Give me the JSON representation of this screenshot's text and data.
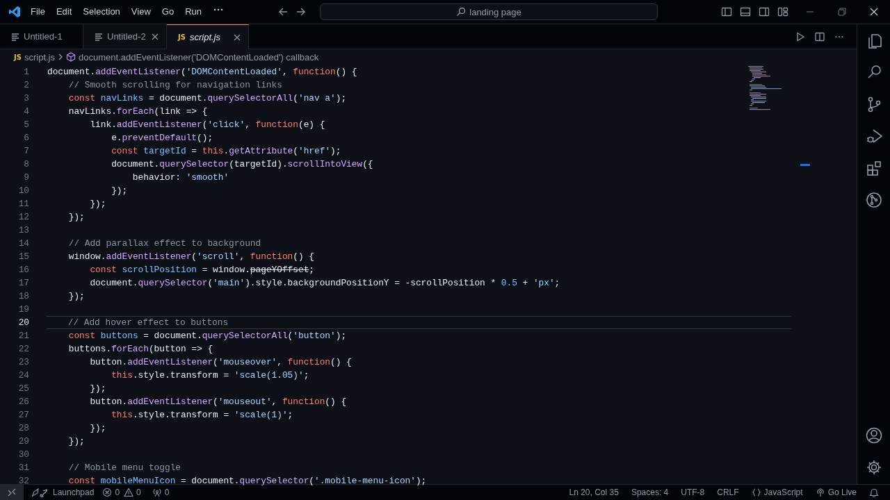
{
  "title_bar": {
    "menu": [
      "File",
      "Edit",
      "Selection",
      "View",
      "Go",
      "Run"
    ],
    "search": {
      "value": "landing page"
    }
  },
  "tabs": [
    {
      "label": "Untitled-1",
      "kind": "text",
      "selected": false,
      "hovered": false,
      "preview": false
    },
    {
      "label": "Untitled-2",
      "kind": "text",
      "selected": false,
      "hovered": true,
      "preview": false
    },
    {
      "label": "script.js",
      "kind": "js",
      "icon_text": "JS",
      "selected": true,
      "hovered": false,
      "preview": true
    }
  ],
  "breadcrumb": [
    {
      "label": "script.js",
      "kind": "js",
      "icon_text": "JS"
    },
    {
      "label": "document.addEventListener('DOMContentLoaded') callback",
      "kind": "symbol"
    }
  ],
  "editor": {
    "lines": [
      {
        "number": "1",
        "current": false,
        "tokens": [
          {
            "kind": "plain",
            "text": "document."
          },
          {
            "kind": "fn",
            "text": "addEventListener"
          },
          {
            "kind": "plain",
            "text": "("
          },
          {
            "kind": "str",
            "text": "'DOMContentLoaded'"
          },
          {
            "kind": "plain",
            "text": ", "
          },
          {
            "kind": "kw",
            "text": "function"
          },
          {
            "kind": "plain",
            "text": "() {"
          }
        ]
      },
      {
        "number": "2",
        "current": false,
        "tokens": [
          {
            "kind": "com",
            "text": "    // Smooth scrolling for navigation links"
          }
        ]
      },
      {
        "number": "3",
        "current": false,
        "tokens": [
          {
            "kind": "kw",
            "text": "    const"
          },
          {
            "kind": "def",
            "text": " navLinks"
          },
          {
            "kind": "plain",
            "text": " = document."
          },
          {
            "kind": "fn",
            "text": "querySelectorAll"
          },
          {
            "kind": "plain",
            "text": "("
          },
          {
            "kind": "str",
            "text": "'nav a'"
          },
          {
            "kind": "plain",
            "text": ");"
          }
        ]
      },
      {
        "number": "4",
        "current": false,
        "tokens": [
          {
            "kind": "plain",
            "text": "    navLinks."
          },
          {
            "kind": "fn",
            "text": "forEach"
          },
          {
            "kind": "plain",
            "text": "(link => {"
          }
        ]
      },
      {
        "number": "5",
        "current": false,
        "tokens": [
          {
            "kind": "plain",
            "text": "        link."
          },
          {
            "kind": "fn",
            "text": "addEventListener"
          },
          {
            "kind": "plain",
            "text": "("
          },
          {
            "kind": "str",
            "text": "'click'"
          },
          {
            "kind": "plain",
            "text": ", "
          },
          {
            "kind": "kw",
            "text": "function"
          },
          {
            "kind": "plain",
            "text": "(e) {"
          }
        ]
      },
      {
        "number": "6",
        "current": false,
        "tokens": [
          {
            "kind": "plain",
            "text": "            e."
          },
          {
            "kind": "fn",
            "text": "preventDefault"
          },
          {
            "kind": "plain",
            "text": "();"
          }
        ]
      },
      {
        "number": "7",
        "current": false,
        "tokens": [
          {
            "kind": "kw",
            "text": "            const"
          },
          {
            "kind": "def",
            "text": " targetId"
          },
          {
            "kind": "plain",
            "text": " = "
          },
          {
            "kind": "kw",
            "text": "this"
          },
          {
            "kind": "plain",
            "text": "."
          },
          {
            "kind": "fn",
            "text": "getAttribute"
          },
          {
            "kind": "plain",
            "text": "("
          },
          {
            "kind": "str",
            "text": "'href'"
          },
          {
            "kind": "plain",
            "text": ");"
          }
        ]
      },
      {
        "number": "8",
        "current": false,
        "tokens": [
          {
            "kind": "plain",
            "text": "            document."
          },
          {
            "kind": "fn",
            "text": "querySelector"
          },
          {
            "kind": "plain",
            "text": "(targetId)."
          },
          {
            "kind": "fn",
            "text": "scrollIntoView"
          },
          {
            "kind": "plain",
            "text": "({"
          }
        ]
      },
      {
        "number": "9",
        "current": false,
        "tokens": [
          {
            "kind": "plain",
            "text": "                behavior: "
          },
          {
            "kind": "str",
            "text": "'smooth'"
          }
        ]
      },
      {
        "number": "10",
        "current": false,
        "tokens": [
          {
            "kind": "plain",
            "text": "            });"
          }
        ]
      },
      {
        "number": "11",
        "current": false,
        "tokens": [
          {
            "kind": "plain",
            "text": "        });"
          }
        ]
      },
      {
        "number": "12",
        "current": false,
        "tokens": [
          {
            "kind": "plain",
            "text": "    });"
          }
        ]
      },
      {
        "number": "13",
        "current": false
      },
      {
        "number": "14",
        "current": false,
        "tokens": [
          {
            "kind": "com",
            "text": "    // Add parallax effect to background"
          }
        ]
      },
      {
        "number": "15",
        "current": false,
        "tokens": [
          {
            "kind": "plain",
            "text": "    window."
          },
          {
            "kind": "fn",
            "text": "addEventListener"
          },
          {
            "kind": "plain",
            "text": "("
          },
          {
            "kind": "str",
            "text": "'scroll'"
          },
          {
            "kind": "plain",
            "text": ", "
          },
          {
            "kind": "kw",
            "text": "function"
          },
          {
            "kind": "plain",
            "text": "() {"
          }
        ]
      },
      {
        "number": "16",
        "current": false,
        "tokens": [
          {
            "kind": "kw",
            "text": "        const"
          },
          {
            "kind": "def",
            "text": " scrollPosition"
          },
          {
            "kind": "plain",
            "text": " = window."
          },
          {
            "kind": "dep",
            "text": "pageYOffset"
          },
          {
            "kind": "plain",
            "text": ";"
          }
        ]
      },
      {
        "number": "17",
        "current": false,
        "tokens": [
          {
            "kind": "plain",
            "text": "        document."
          },
          {
            "kind": "fn",
            "text": "querySelector"
          },
          {
            "kind": "plain",
            "text": "("
          },
          {
            "kind": "str",
            "text": "'main'"
          },
          {
            "kind": "plain",
            "text": ").style.backgroundPositionY = -scrollPosition * "
          },
          {
            "kind": "num",
            "text": "0.5"
          },
          {
            "kind": "plain",
            "text": " + "
          },
          {
            "kind": "str",
            "text": "'px'"
          },
          {
            "kind": "plain",
            "text": ";"
          }
        ]
      },
      {
        "number": "18",
        "current": false,
        "tokens": [
          {
            "kind": "plain",
            "text": "    });"
          }
        ]
      },
      {
        "number": "19",
        "current": false
      },
      {
        "number": "20",
        "current": true,
        "tokens": [
          {
            "kind": "com",
            "text": "    // Add hover effect to buttons"
          }
        ]
      },
      {
        "number": "21",
        "current": false,
        "tokens": [
          {
            "kind": "kw",
            "text": "    const"
          },
          {
            "kind": "def",
            "text": " buttons"
          },
          {
            "kind": "plain",
            "text": " = document."
          },
          {
            "kind": "fn",
            "text": "querySelectorAll"
          },
          {
            "kind": "plain",
            "text": "("
          },
          {
            "kind": "str",
            "text": "'button'"
          },
          {
            "kind": "plain",
            "text": ");"
          }
        ]
      },
      {
        "number": "22",
        "current": false,
        "tokens": [
          {
            "kind": "plain",
            "text": "    buttons."
          },
          {
            "kind": "fn",
            "text": "forEach"
          },
          {
            "kind": "plain",
            "text": "(button => {"
          }
        ]
      },
      {
        "number": "23",
        "current": false,
        "tokens": [
          {
            "kind": "plain",
            "text": "        button."
          },
          {
            "kind": "fn",
            "text": "addEventListener"
          },
          {
            "kind": "plain",
            "text": "("
          },
          {
            "kind": "str",
            "text": "'mouseover'"
          },
          {
            "kind": "plain",
            "text": ", "
          },
          {
            "kind": "kw",
            "text": "function"
          },
          {
            "kind": "plain",
            "text": "() {"
          }
        ]
      },
      {
        "number": "24",
        "current": false,
        "tokens": [
          {
            "kind": "kw",
            "text": "            this"
          },
          {
            "kind": "plain",
            "text": ".style.transform = "
          },
          {
            "kind": "str",
            "text": "'scale(1.05)'"
          },
          {
            "kind": "plain",
            "text": ";"
          }
        ]
      },
      {
        "number": "25",
        "current": false,
        "tokens": [
          {
            "kind": "plain",
            "text": "        });"
          }
        ]
      },
      {
        "number": "26",
        "current": false,
        "tokens": [
          {
            "kind": "plain",
            "text": "        button."
          },
          {
            "kind": "fn",
            "text": "addEventListener"
          },
          {
            "kind": "plain",
            "text": "("
          },
          {
            "kind": "str",
            "text": "'mouseout'"
          },
          {
            "kind": "plain",
            "text": ", "
          },
          {
            "kind": "kw",
            "text": "function"
          },
          {
            "kind": "plain",
            "text": "() {"
          }
        ]
      },
      {
        "number": "27",
        "current": false,
        "tokens": [
          {
            "kind": "kw",
            "text": "            this"
          },
          {
            "kind": "plain",
            "text": ".style.transform = "
          },
          {
            "kind": "str",
            "text": "'scale(1)'"
          },
          {
            "kind": "plain",
            "text": ";"
          }
        ]
      },
      {
        "number": "28",
        "current": false,
        "tokens": [
          {
            "kind": "plain",
            "text": "        });"
          }
        ]
      },
      {
        "number": "29",
        "current": false,
        "tokens": [
          {
            "kind": "plain",
            "text": "    });"
          }
        ]
      },
      {
        "number": "30",
        "current": false
      },
      {
        "number": "31",
        "current": false,
        "tokens": [
          {
            "kind": "com",
            "text": "    // Mobile menu toggle"
          }
        ]
      },
      {
        "number": "32",
        "current": false,
        "tokens": [
          {
            "kind": "kw",
            "text": "    const"
          },
          {
            "kind": "def",
            "text": " mobileMenuIcon"
          },
          {
            "kind": "plain",
            "text": " = document."
          },
          {
            "kind": "fn",
            "text": "querySelector"
          },
          {
            "kind": "plain",
            "text": "("
          },
          {
            "kind": "str",
            "text": "'.mobile-menu-icon'"
          },
          {
            "kind": "plain",
            "text": ");"
          }
        ]
      }
    ]
  },
  "status_bar": {
    "left": [
      {
        "kind": "remote"
      },
      {
        "kind": "launchpad",
        "text": "Launchpad"
      },
      {
        "kind": "errors",
        "text": "0"
      },
      {
        "kind": "warnings",
        "text": "0"
      },
      {
        "kind": "ports",
        "text": "0"
      }
    ],
    "right": [
      {
        "kind": "plain",
        "text": "Ln 20, Col 35"
      },
      {
        "kind": "plain",
        "text": "Spaces: 4"
      },
      {
        "kind": "plain",
        "text": "UTF-8"
      },
      {
        "kind": "plain",
        "text": "CRLF"
      },
      {
        "kind": "language",
        "text": "JavaScript"
      },
      {
        "kind": "live",
        "text": "Go Live"
      },
      {
        "kind": "bell"
      }
    ]
  }
}
